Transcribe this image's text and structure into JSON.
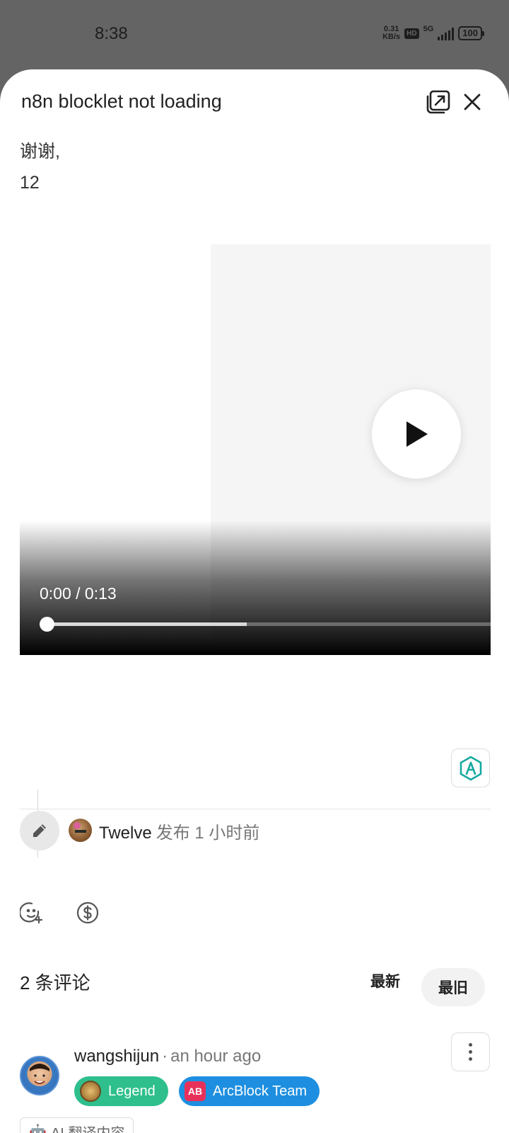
{
  "status_bar": {
    "time": "8:38",
    "net_speed_value": "0.31",
    "net_speed_unit": "KB/s",
    "hd": "HD",
    "network": "5G",
    "battery": "100"
  },
  "sheet": {
    "title": "n8n blocklet not loading"
  },
  "post": {
    "line1": "谢谢,",
    "line2": "12"
  },
  "video": {
    "time_label": "0:00 / 0:13",
    "progress": 0,
    "buffered": 0.45
  },
  "author": {
    "name": "Twelve",
    "posted": "发布 1 小时前"
  },
  "comments": {
    "count_label": "2 条评论",
    "sort_newest": "最新",
    "sort_oldest": "最旧",
    "items": [
      {
        "user": "wangshijun",
        "separator": "·",
        "time": "an hour ago",
        "badges": [
          "Legend",
          "ArcBlock Team"
        ],
        "team_badge_icon_text": "AB",
        "translate_label": "AI 翻译内容"
      }
    ]
  },
  "colors": {
    "legend_badge": "#2ebf8c",
    "team_badge": "#1e8fe0",
    "ai_badge": "#18a8a0"
  }
}
